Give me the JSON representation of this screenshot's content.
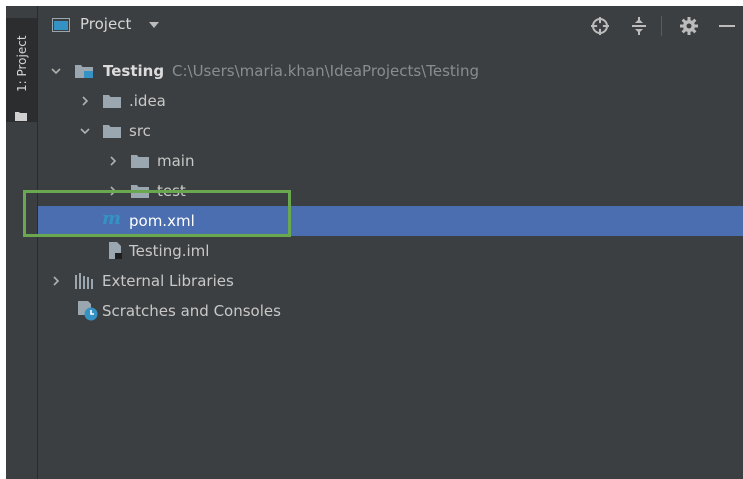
{
  "tool_window": {
    "strip_label": "1: Project",
    "title": "Project"
  },
  "tree": {
    "root_name": "Testing",
    "root_path": "C:\\Users\\maria.khan\\IdeaProjects\\Testing",
    "idea": ".idea",
    "src": "src",
    "main": "main",
    "test": "test",
    "pom": "pom.xml",
    "iml": "Testing.iml",
    "external_libraries": "External Libraries",
    "scratches": "Scratches and Consoles"
  },
  "colors": {
    "background": "#3c3f41",
    "selection": "#4a6eaf",
    "highlight_box": "#6aa84f",
    "folder": "#9aa7b0",
    "maven": "#3592c4"
  },
  "icons": [
    "project-window-icon",
    "caret-down-icon",
    "locate-icon",
    "collapse-all-icon",
    "gear-icon",
    "hide-icon",
    "folder-icon",
    "maven-icon",
    "iml-file-icon",
    "libraries-icon",
    "scratches-icon"
  ]
}
